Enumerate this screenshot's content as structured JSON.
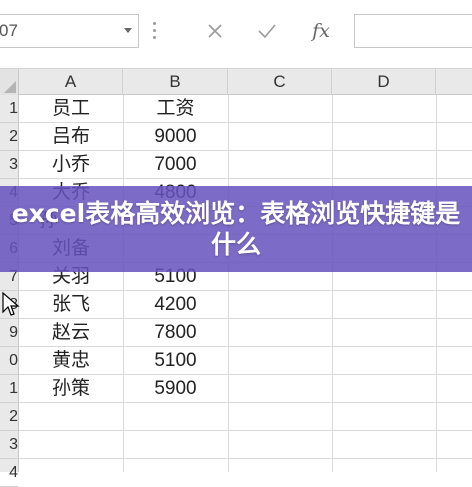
{
  "formula_bar": {
    "name_box_value": "07",
    "fx_label": "fx"
  },
  "columns": [
    "A",
    "B",
    "C",
    "D"
  ],
  "rows": [
    "1",
    "2",
    "3",
    "4",
    "5",
    "6",
    "7",
    "8",
    "9",
    "0",
    "1",
    "2",
    "3",
    "4"
  ],
  "table": {
    "headers": [
      "员工",
      "工资"
    ],
    "data": [
      [
        "吕布",
        "9000"
      ],
      [
        "小乔",
        "7000"
      ],
      [
        "大乔",
        "4800"
      ],
      [
        "孙",
        ""
      ],
      [
        "刘备",
        ""
      ],
      [
        "关羽",
        "5100"
      ],
      [
        "张飞",
        "4200"
      ],
      [
        "赵云",
        "7800"
      ],
      [
        "黄忠",
        "5100"
      ],
      [
        "孙策",
        "5900"
      ]
    ]
  },
  "banner": {
    "title": "excel表格高效浏览：表格浏览快捷键是什么"
  },
  "colors": {
    "banner": "#6854be",
    "header_bg": "#e9e9e9",
    "gridline": "#dadada"
  }
}
